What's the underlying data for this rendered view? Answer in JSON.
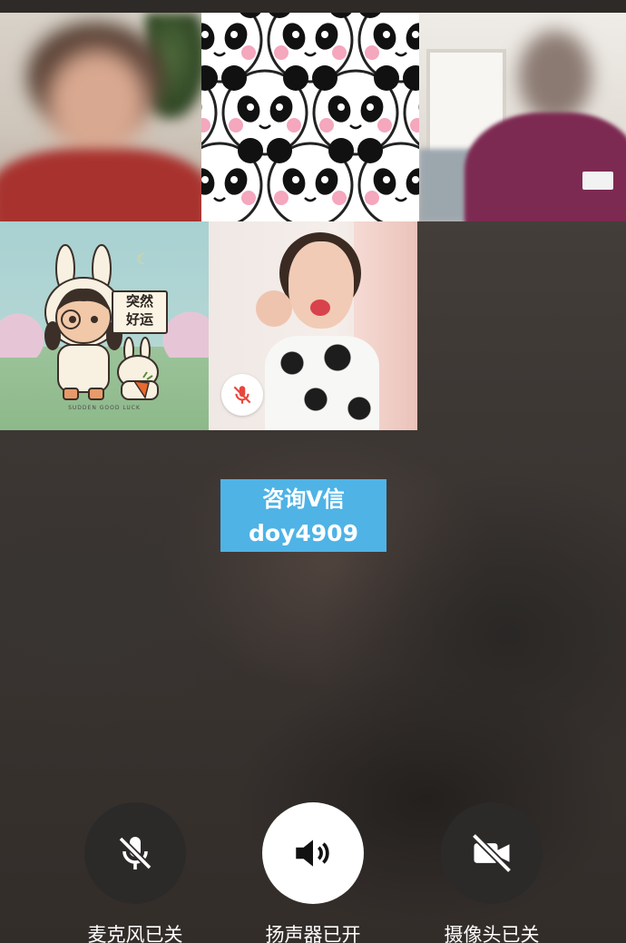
{
  "participants": [
    {
      "id": "p1",
      "kind": "camera-video",
      "muted": false
    },
    {
      "id": "p2",
      "kind": "avatar-panda-pattern",
      "muted": false
    },
    {
      "id": "p3",
      "kind": "camera-video",
      "muted": false
    },
    {
      "id": "p4",
      "kind": "avatar-cartoon",
      "muted": false,
      "sign_text": "突然\n好运",
      "caption": "SUDDEN GOOD LUCK"
    },
    {
      "id": "p5",
      "kind": "camera-video",
      "muted": true
    }
  ],
  "watermark": {
    "line1": "咨询V信",
    "line2": "doy4909",
    "color": "#4fb3e6"
  },
  "controls": {
    "microphone": {
      "label": "麦克风已关",
      "state": "off",
      "icon": "mic-off-icon"
    },
    "speaker": {
      "label": "扬声器已开",
      "state": "on",
      "icon": "speaker-on-icon"
    },
    "camera": {
      "label": "摄像头已关",
      "state": "off",
      "icon": "camera-off-icon"
    }
  },
  "colors": {
    "control_dark": "#2c2a29",
    "control_light": "#ffffff",
    "mute_red": "#e8463c"
  }
}
